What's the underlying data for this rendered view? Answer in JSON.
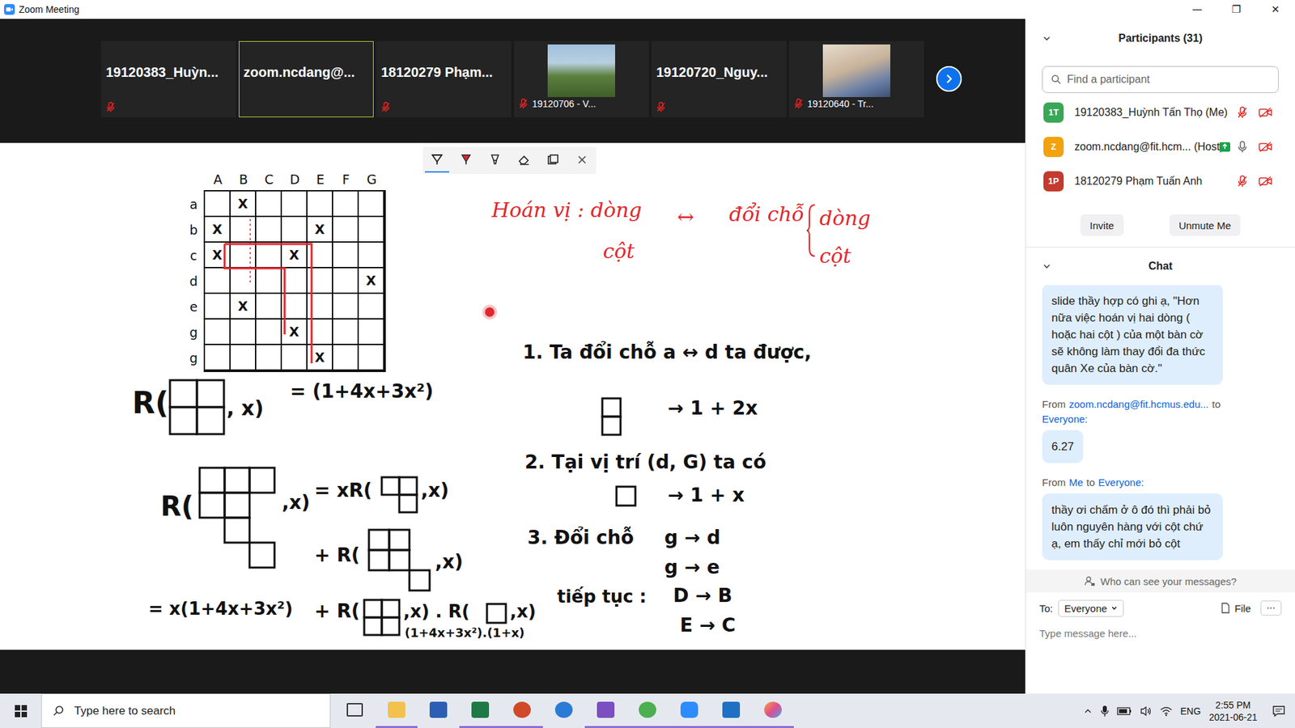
{
  "window": {
    "title": "Zoom Meeting",
    "controls": [
      "—",
      "❐",
      "✕"
    ]
  },
  "thumbnails": [
    {
      "name": "19120383_Huỳn...",
      "kind": "name",
      "muted": true,
      "speaking": false
    },
    {
      "name": "zoom.ncdang@...",
      "kind": "name",
      "muted": false,
      "speaking": true
    },
    {
      "name": "18120279  Phạm...",
      "kind": "name",
      "muted": true,
      "speaking": false
    },
    {
      "name": "19120706 - V...",
      "kind": "photo",
      "muted": true,
      "speaking": false
    },
    {
      "name": "19120720_Nguy...",
      "kind": "name",
      "muted": true,
      "speaking": false
    },
    {
      "name": "19120640 - Tr...",
      "kind": "photo",
      "muted": true,
      "speaking": false
    }
  ],
  "whiteboard": {
    "tools": [
      {
        "kind": "pen",
        "selected": true
      },
      {
        "kind": "marker",
        "selected": false
      },
      {
        "kind": "highlighter",
        "selected": false
      },
      {
        "kind": "eraser",
        "selected": false
      },
      {
        "kind": "copy",
        "selected": false
      },
      {
        "kind": "close",
        "selected": false
      }
    ],
    "board": {
      "columns": [
        "A",
        "B",
        "C",
        "D",
        "E",
        "F",
        "G"
      ],
      "rows": [
        "a",
        "b",
        "c",
        "d",
        "e",
        "g",
        "g"
      ],
      "mark": "X",
      "rooks": [
        [
          0,
          1
        ],
        [
          1,
          0
        ],
        [
          1,
          4
        ],
        [
          2,
          0
        ],
        [
          2,
          3
        ],
        [
          3,
          6
        ],
        [
          4,
          1
        ],
        [
          5,
          3
        ],
        [
          6,
          4
        ]
      ]
    },
    "notes": [
      {
        "text": "Hoán vị : dòng",
        "color": "#e3262c"
      },
      {
        "text": "cột",
        "color": "#e3262c"
      },
      {
        "text": "↔",
        "color": "#e3262c"
      },
      {
        "text": "đổi chỗ",
        "color": "#e3262c"
      },
      {
        "text": "dòng",
        "color": "#e3262c"
      },
      {
        "text": "cột",
        "color": "#e3262c"
      },
      {
        "text": "1.  Ta đổi chỗ  a ↔ d  ta được,",
        "color": "#111111"
      },
      {
        "text": "→  1 + 2x",
        "color": "#111111"
      },
      {
        "text": "2.  Tại vị trí  (d, G)  ta có",
        "color": "#111111"
      },
      {
        "text": "→  1 + x",
        "color": "#111111"
      },
      {
        "text": "3.  Đổi chỗ",
        "color": "#111111"
      },
      {
        "text": "g → d",
        "color": "#111111"
      },
      {
        "text": "g → e",
        "color": "#111111"
      },
      {
        "text": "tiếp tục :",
        "color": "#111111"
      },
      {
        "text": "D → B",
        "color": "#111111"
      },
      {
        "text": "E → C",
        "color": "#111111"
      },
      {
        "text": "R(",
        "color": "#111111"
      },
      {
        "text": ", x)",
        "color": "#111111"
      },
      {
        "text": "= (1+4x+3x²)",
        "color": "#111111"
      },
      {
        "text": "R(",
        "color": "#111111"
      },
      {
        "text": ",x)",
        "color": "#111111"
      },
      {
        "text": "= xR(",
        "color": "#111111"
      },
      {
        "text": ",x)",
        "color": "#111111"
      },
      {
        "text": "+ R(",
        "color": "#111111"
      },
      {
        "text": ",x)",
        "color": "#111111"
      },
      {
        "text": "= x(1+4x+3x²)",
        "color": "#111111"
      },
      {
        "text": "+ R(",
        "color": "#111111"
      },
      {
        "text": ",x) . R(",
        "color": "#111111"
      },
      {
        "text": ",x)",
        "color": "#111111"
      },
      {
        "text": "(1+4x+3x²).(1+x)",
        "color": "#111111"
      }
    ]
  },
  "participants": {
    "title": "Participants (31)",
    "search_placeholder": "Find a participant",
    "items": [
      {
        "initials": "1T",
        "name": "19120383_Huỳnh Tấn Thọ (Me)",
        "color": "#3aa757",
        "muted": true,
        "video": false,
        "sharing": false
      },
      {
        "initials": "Z",
        "name": "zoom.ncdang@fit.hcm... (Host)",
        "color": "#f2a20c",
        "muted": false,
        "video": false,
        "sharing": true
      },
      {
        "initials": "1P",
        "name": "18120279 Phạm Tuấn Anh",
        "color": "#c23b2e",
        "muted": true,
        "video": false,
        "sharing": false
      }
    ],
    "buttons": [
      "Invite",
      "Unmute Me"
    ]
  },
  "chat": {
    "title": "Chat",
    "messages": [
      {
        "header": null,
        "text": "slide thầy hợp có ghi ạ, \"Hơn nữa việc hoán vị hai dòng ( hoặc hai cột ) của một bàn cờ sẽ không làm thay đổi đa thức quân Xe của bàn cờ.\""
      },
      {
        "header": {
          "from": "From",
          "sender": "zoom.ncdang@fit.hcmus.edu...",
          "to": "to",
          "recipient": "Everyone:"
        },
        "text": "6.27"
      },
      {
        "header": {
          "from": "From",
          "sender": "Me",
          "to": "to",
          "recipient": "Everyone:"
        },
        "text": "thầy ơi chấm ở ô đó thì phải bỏ luôn nguyên hàng với cột chứ ạ, em thấy chỉ mới bỏ cột"
      }
    ],
    "privacy": "Who can see your messages?",
    "to_label": "To:",
    "recipient": "Everyone",
    "file": "File",
    "more": "···",
    "placeholder": "Type message here..."
  },
  "taskbar": {
    "search_placeholder": "Type here to search",
    "apps": [
      {
        "kind": "taskview",
        "active": false
      },
      {
        "kind": "explorer",
        "active": true
      },
      {
        "kind": "word",
        "active": false
      },
      {
        "kind": "excel",
        "active": true
      },
      {
        "kind": "powerpoint",
        "active": true
      },
      {
        "kind": "teams",
        "active": false
      },
      {
        "kind": "studio",
        "active": true
      },
      {
        "kind": "green",
        "active": true
      },
      {
        "kind": "zoom",
        "active": true
      },
      {
        "kind": "slides",
        "active": true
      },
      {
        "kind": "paint",
        "active": true
      }
    ],
    "language": "ENG",
    "time": "2:55 PM",
    "date": "2021-06-21"
  }
}
